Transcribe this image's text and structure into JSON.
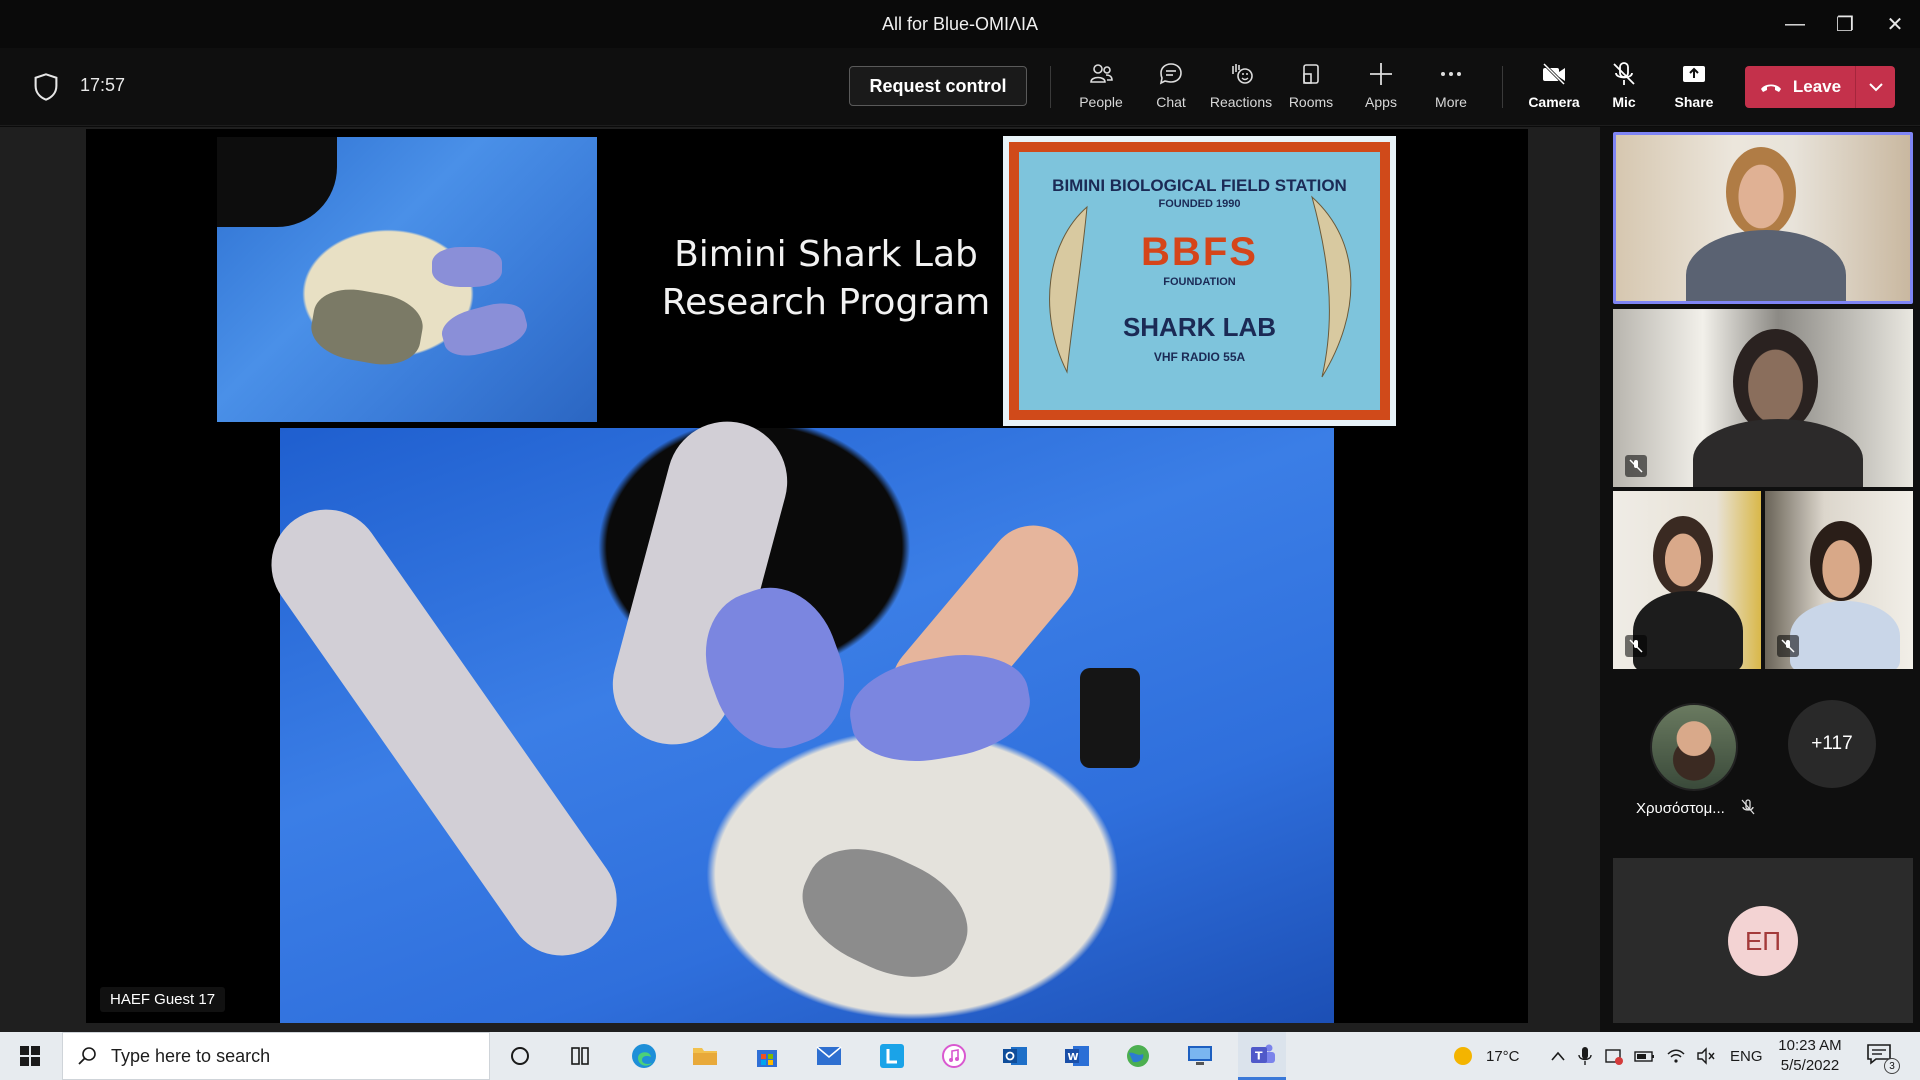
{
  "window": {
    "title": "All for Blue-ΟΜΙΛΙΑ",
    "controls": {
      "minimize": "—",
      "restore": "❐",
      "close": "✕"
    }
  },
  "meeting": {
    "elapsed_time": "17:57",
    "request_control_label": "Request control",
    "tools": [
      {
        "label": "People",
        "icon": "people-icon"
      },
      {
        "label": "Chat",
        "icon": "chat-icon"
      },
      {
        "label": "Reactions",
        "icon": "reactions-icon"
      },
      {
        "label": "Rooms",
        "icon": "rooms-icon"
      },
      {
        "label": "Apps",
        "icon": "apps-icon"
      },
      {
        "label": "More",
        "icon": "more-icon"
      }
    ],
    "av_controls": [
      {
        "label": "Camera",
        "icon": "camera-off-icon"
      },
      {
        "label": "Mic",
        "icon": "mic-off-icon"
      },
      {
        "label": "Share",
        "icon": "share-icon"
      }
    ],
    "leave_label": "Leave",
    "leave_color": "#c4314b"
  },
  "slide": {
    "title_line1": "Bimini Shark Lab",
    "title_line2": "Research Program",
    "sign": {
      "line1": "BIMINI BIOLOGICAL FIELD STATION",
      "line2": "FOUNDED 1990",
      "line3": "BBFS",
      "line4": "FOUNDATION",
      "line5": "SHARK LAB",
      "line6": "VHF RADIO 55A"
    },
    "presenter_name": "HAEF Guest 17"
  },
  "participants": {
    "active_border_color": "#7f85f5",
    "named_participant": "Χρυσόστομ...",
    "overflow_count": "+117",
    "initials": "ΕΠ"
  },
  "taskbar": {
    "search_placeholder": "Type here to search",
    "weather_temp": "17°C",
    "language": "ENG",
    "time": "10:23 AM",
    "date": "5/5/2022",
    "notification_count": "3"
  }
}
